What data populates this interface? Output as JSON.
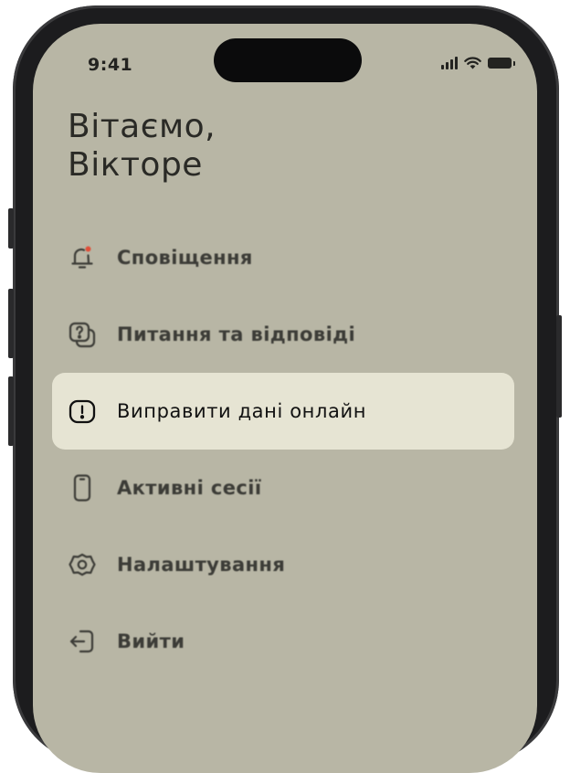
{
  "status_bar": {
    "time": "9:41"
  },
  "greeting": {
    "line1": "Вітаємо,",
    "line2": "Вікторе"
  },
  "menu": {
    "items": [
      {
        "label": "Сповіщення",
        "icon": "bell-icon",
        "has_badge": true,
        "active": false
      },
      {
        "label": "Питання та відповіді",
        "icon": "chat-question-icon",
        "active": false
      },
      {
        "label": "Виправити дані онлайн",
        "icon": "alert-square-icon",
        "active": true
      },
      {
        "label": "Активні сесії",
        "icon": "smartphone-icon",
        "active": false
      },
      {
        "label": "Налаштування",
        "icon": "gear-icon",
        "active": false
      },
      {
        "label": "Вийти",
        "icon": "logout-icon",
        "active": false
      }
    ]
  },
  "colors": {
    "screen_bg": "#b8b6a5",
    "highlight_bg": "#e6e4d3",
    "badge": "#e0503a",
    "text": "#2a2a26"
  }
}
